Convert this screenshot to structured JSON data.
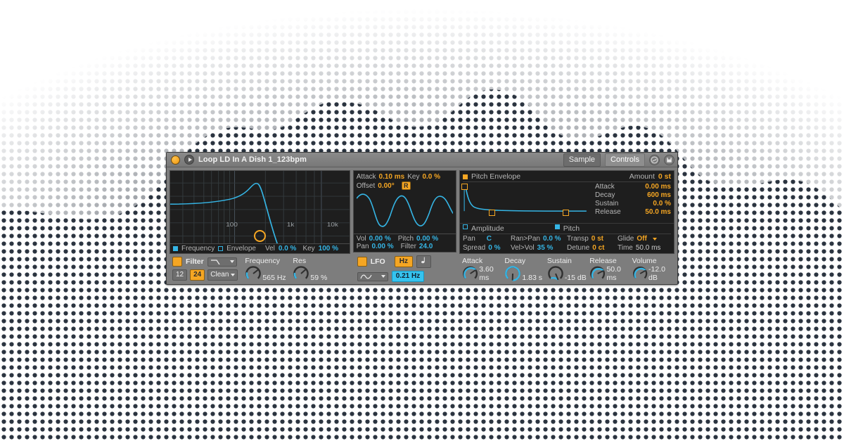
{
  "window": {
    "power_led": "power-led",
    "play_icon": "play-triangle",
    "title": "Loop LD In A Dish 1_123bpm",
    "tab_sample": "Sample",
    "tab_controls": "Controls",
    "icon_link": "link-circle-icon",
    "icon_save": "save-disk-icon"
  },
  "filter": {
    "section_label": "Filter",
    "enabled": true,
    "type_glyph": "lowpass-curve",
    "slope_12": "12",
    "slope_24": "24",
    "slope_selected": "24",
    "circuit": "Clean",
    "freq_label": "Frequency",
    "freq_value": "565 Hz",
    "res_label": "Res",
    "res_value": "59 %",
    "legend": {
      "frequency": "Frequency",
      "envelope": "Envelope",
      "vel_label": "Vel",
      "vel_value": "0.0 %",
      "key_label": "Key",
      "key_value": "100 %"
    },
    "axis_ticks": [
      "100",
      "1k",
      "10k"
    ]
  },
  "lfo": {
    "section_label": "LFO",
    "enabled": true,
    "attack_label": "Attack",
    "attack_value": "0.10 ms",
    "key_label": "Key",
    "key_value": "0.0 %",
    "offset_label": "Offset",
    "offset_value": "0.00°",
    "retrigger": "R",
    "waveform": "sine",
    "mode_hz": "Hz",
    "mode_note": "note-sync-icon",
    "mode_selected": "Hz",
    "rate_value": "0.21 Hz",
    "dest": {
      "vol_label": "Vol",
      "vol_value": "0.00 %",
      "pitch_label": "Pitch",
      "pitch_value": "0.00 %",
      "pan_label": "Pan",
      "pan_value": "0.00 %",
      "filter_label": "Filter",
      "filter_value": "24.0"
    }
  },
  "pitch_envelope": {
    "title": "Pitch Envelope",
    "enabled": true,
    "amount_label": "Amount",
    "amount_value": "0 st",
    "attack_label": "Attack",
    "attack_value": "0.00 ms",
    "decay_label": "Decay",
    "decay_value": "600 ms",
    "sustain_label": "Sustain",
    "sustain_value": "0.0 %",
    "release_label": "Release",
    "release_value": "50.0 ms"
  },
  "amp_pitch": {
    "tab_amplitude": "Amplitude",
    "tab_pitch": "Pitch",
    "selected_tab": "Pitch",
    "pan_label": "Pan",
    "pan_value": "C",
    "spread_label": "Spread",
    "spread_value": "0 %",
    "ranpan_label": "Ran>Pan",
    "ranpan_value": "0.0 %",
    "velvol_label": "Vel>Vol",
    "velvol_value": "35 %",
    "transp_label": "Transp",
    "transp_value": "0 st",
    "detune_label": "Detune",
    "detune_value": "0 ct",
    "glide_label": "Glide",
    "glide_value": "Off",
    "time_label": "Time",
    "time_value": "50.0 ms"
  },
  "knobs": [
    {
      "label": "Attack",
      "value": "3.60 ms",
      "angle": 56
    },
    {
      "label": "Decay",
      "value": "1.83 s",
      "angle": 182
    },
    {
      "label": "Sustain",
      "value": "-15 dB",
      "angle": 158
    },
    {
      "label": "Release",
      "value": "50.0 ms",
      "angle": 64
    },
    {
      "label": "Volume",
      "value": "-12.0 dB",
      "angle": 60
    }
  ],
  "colors": {
    "accent_orange": "#f5a623",
    "accent_cyan": "#35b5e5",
    "panel_grey": "#7d7d7d",
    "display_black": "#1e1e1e"
  }
}
